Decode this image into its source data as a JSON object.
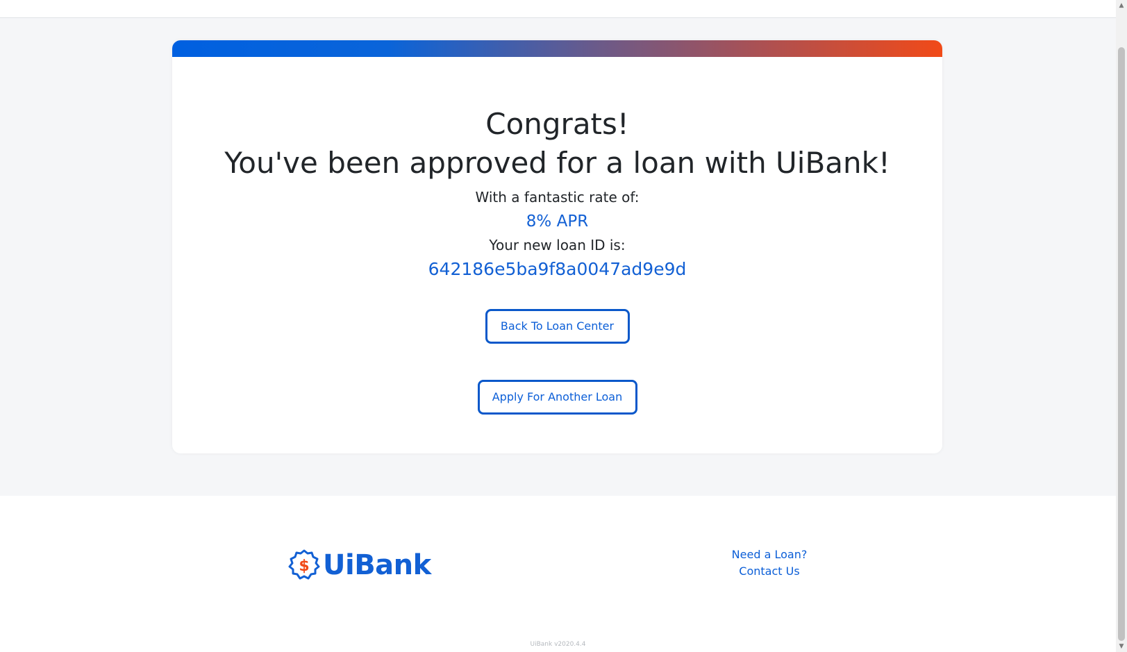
{
  "card": {
    "heading_line1": "Congrats!",
    "heading_line2": "You've been approved for a loan with UiBank!",
    "rate_label": "With a fantastic rate of:",
    "rate_value": "8% APR",
    "loan_id_label": "Your new loan ID is:",
    "loan_id_value": "642186e5ba9f8a0047ad9e9d",
    "back_button": "Back To Loan Center",
    "apply_button": "Apply For Another Loan"
  },
  "footer": {
    "logo_text": "UiBank",
    "logo_icon": "dollar-badge-icon",
    "links": [
      "Need a Loan?",
      "Contact Us"
    ],
    "version": "UiBank v2020.4.4"
  },
  "colors": {
    "accent_blue": "#1260d4",
    "gradient_start": "#0060e0",
    "gradient_end": "#f14a18",
    "text_dark": "#212529",
    "background": "#f5f6f8"
  },
  "scrollbar": {
    "up_icon": "scroll-up-arrow-icon",
    "down_icon": "scroll-down-arrow-icon"
  }
}
